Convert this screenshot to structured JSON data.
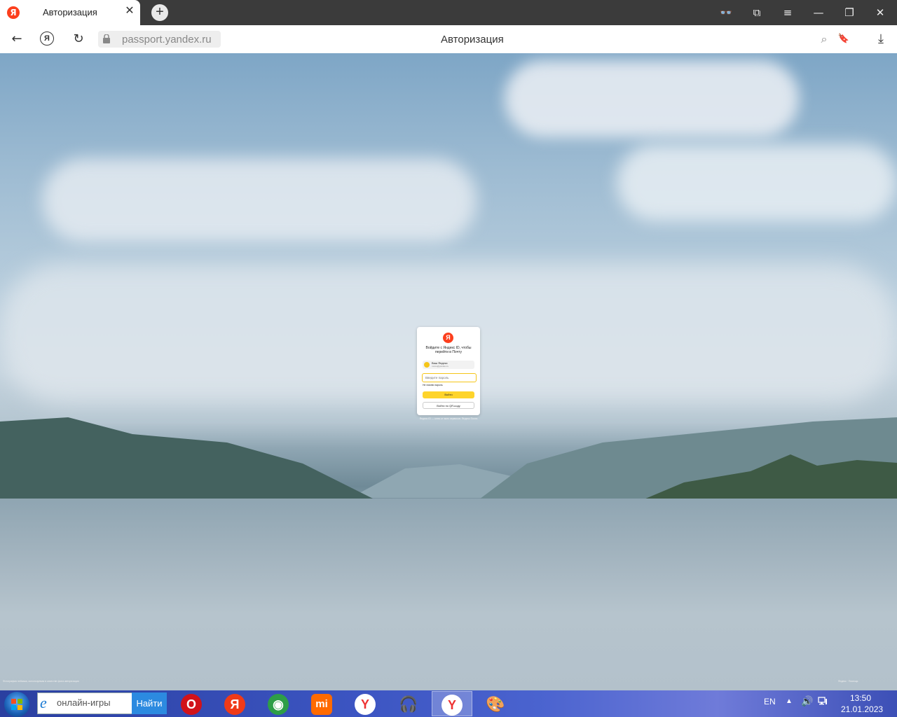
{
  "browser": {
    "tab": {
      "favicon": "Я",
      "title": "Авторизация",
      "close": "✕"
    },
    "new_tab": "+",
    "window_controls": {
      "reader": "👓",
      "bookmarks": "⧉",
      "menu": "≡",
      "minimize": "—",
      "restore": "❐",
      "close": "✕"
    },
    "nav": {
      "back": "←",
      "yandex": "Я",
      "reload": "↻"
    },
    "url": "passport.yandex.ru",
    "page_title": "Авторизация",
    "toolbar_icons": {
      "lens": "⌕",
      "bookmark": "🔖",
      "download": "⤓"
    }
  },
  "login": {
    "logo": "Я",
    "title": "Войдите с Яндекс ID, чтобы перейти в Почту",
    "account_name": "Ваш Яндекс",
    "account_sub": "логин@yandex.ru",
    "password_placeholder": "Введите пароль",
    "forgot": "Не помню пароль",
    "submit": "Войти",
    "qr": "Войти по QR-коду",
    "footer": "Яндекс ID — ключ от всех сервисов. Яндекс Почта"
  },
  "notes": {
    "left": "Фотография пейзажа, используемая в качестве фона авторизации",
    "right": "Яндекс · Помощь"
  },
  "taskbar": {
    "search_placeholder": "онлайн-игры",
    "search_button": "Найти",
    "apps": [
      {
        "name": "opera",
        "glyph": "O",
        "color": "#d1121a"
      },
      {
        "name": "yandex",
        "glyph": "Я",
        "color": "#f03a17"
      },
      {
        "name": "chrome",
        "glyph": "◉",
        "color": "#2e9e47"
      },
      {
        "name": "xiaomi",
        "glyph": "mi",
        "color": "#ff6a00"
      },
      {
        "name": "yandex-browser",
        "glyph": "Y",
        "color": "#e33"
      },
      {
        "name": "headphones",
        "glyph": "🎧",
        "color": "#3a58d6"
      },
      {
        "name": "yandex-browser-active",
        "glyph": "Y",
        "color": "#e33"
      },
      {
        "name": "paint",
        "glyph": "🎨",
        "color": "#3a58d6"
      }
    ],
    "tray": {
      "lang": "EN",
      "arrow": "▲",
      "volume": "🔊"
    },
    "clock": {
      "time": "13:50",
      "date": "21.01.2023"
    }
  }
}
